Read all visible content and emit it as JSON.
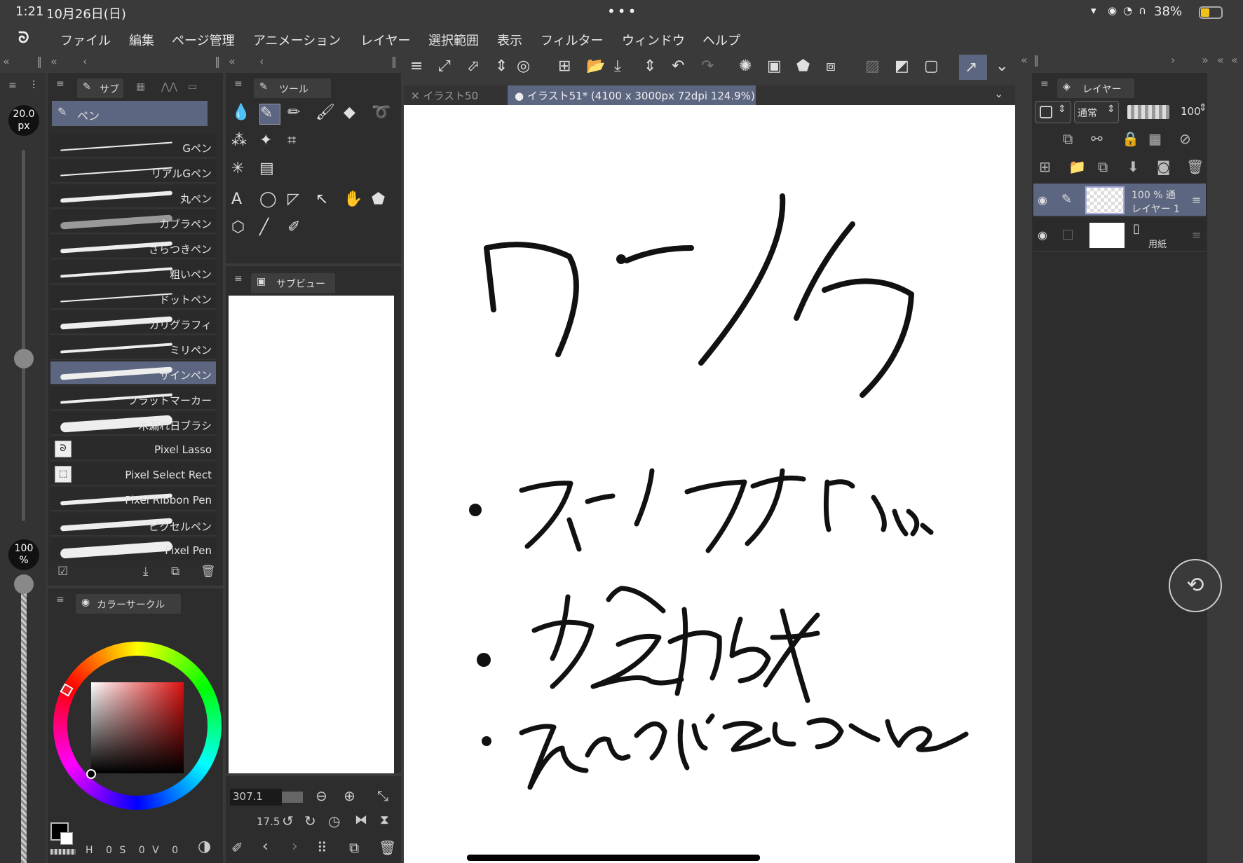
{
  "status": {
    "time": "1:21",
    "date": "10月26日(日)",
    "battery": "38%"
  },
  "menu": [
    "ファイル",
    "編集",
    "ページ管理",
    "アニメーション",
    "レイヤー",
    "選択範囲",
    "表示",
    "フィルター",
    "ウィンドウ",
    "ヘルプ"
  ],
  "left": {
    "brush_size": "20.0",
    "brush_size_unit": "px",
    "opacity": "100",
    "opacity_unit": "%",
    "subtool_tab": "サブ",
    "selected_tool": "ペン",
    "brushes": [
      "Gペン",
      "リアルGペン",
      "丸ペン",
      "カブラペン",
      "ざらつきペン",
      "粗いペン",
      "ドットペン",
      "カリグラフィ",
      "ミリペン",
      "サインペン",
      "フラットマーカー",
      "木漏れ日ブラシ",
      "Pixel Lasso",
      "Pixel Select Rect",
      "Pixel Ribbon Pen",
      "ピクセルペン",
      "Pixel Pen"
    ],
    "selected_brush": "サインペン",
    "color_panel_title": "カラーサークル",
    "hsv": {
      "h_label": "H",
      "h": "0",
      "s_label": "S",
      "s": "0",
      "v_label": "V",
      "v": "0"
    }
  },
  "tools_panel": {
    "title": "ツール",
    "subview_title": "サブビュー",
    "zoom": "307.1",
    "angle": "17.5"
  },
  "canvas": {
    "tabs": [
      {
        "label": "イラスト50",
        "active": false
      },
      {
        "label": "イラスト51* (4100 x 3000px 72dpi 124.9%)",
        "active": true
      }
    ]
  },
  "layers": {
    "title": "レイヤー",
    "blend_mode": "通常",
    "opacity": "100",
    "items": [
      {
        "opacity_line": "100 % 通",
        "name": "レイヤー 1",
        "selected": true
      },
      {
        "opacity_line": "",
        "name": "用紙",
        "selected": false
      }
    ]
  },
  "colors": {
    "panel": "#2d2d2d",
    "bg": "#3a3a3a",
    "selected": "#5d6680",
    "canvas": "#ffffff"
  }
}
